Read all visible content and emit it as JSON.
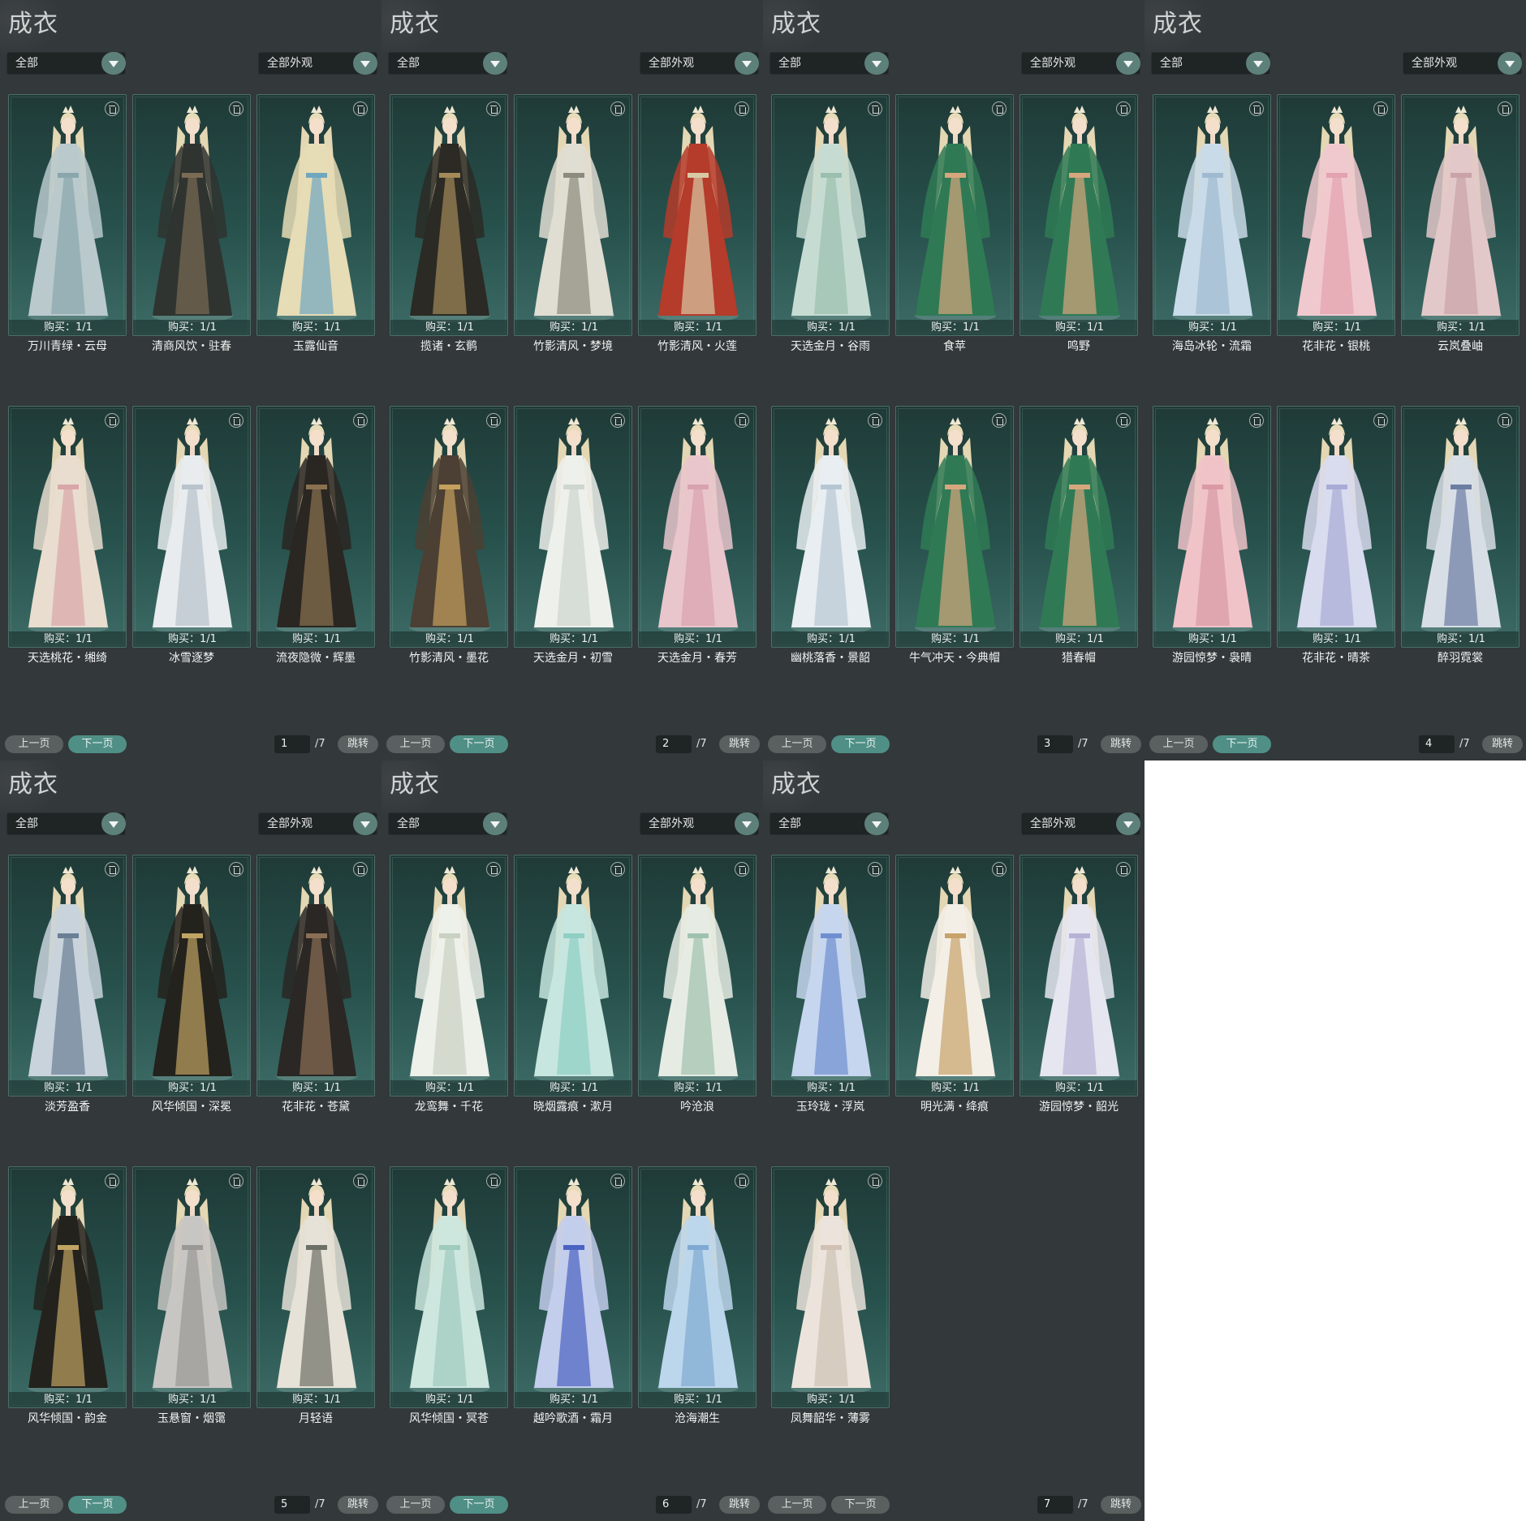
{
  "panels": [
    {
      "title": "成衣",
      "filter_left": "全部",
      "filter_right": "全部外观",
      "page": "1",
      "total": "/7",
      "prev": "上一页",
      "next": "下一页",
      "jump": "跳转",
      "next_enabled": true,
      "items": [
        {
          "name": "万川青绿・云母",
          "purchase": "购买：1/1",
          "dress": "#b9c9cc",
          "accent": "#8aa6ad"
        },
        {
          "name": "清商风饮・驻春",
          "purchase": "购买：1/1",
          "dress": "#2f3430",
          "accent": "#7a6b55"
        },
        {
          "name": "玉露仙音",
          "purchase": "购买：1/1",
          "dress": "#e6dcb5",
          "accent": "#6fa7c0"
        },
        {
          "name": "天选桃花・缃绮",
          "purchase": "购买：1/1",
          "dress": "#e9ddd0",
          "accent": "#d9a6a8"
        },
        {
          "name": "冰雪逐梦",
          "purchase": "购买：1/1",
          "dress": "#e8ecef",
          "accent": "#b9c3cc"
        },
        {
          "name": "流夜隐微・辉墨",
          "purchase": "购买：1/1",
          "dress": "#2a2622",
          "accent": "#8a7250"
        }
      ]
    },
    {
      "title": "成衣",
      "filter_left": "全部",
      "filter_right": "全部外观",
      "page": "2",
      "total": "/7",
      "prev": "上一页",
      "next": "下一页",
      "jump": "跳转",
      "next_enabled": true,
      "items": [
        {
          "name": "揽诸・玄鹡",
          "purchase": "购买：1/1",
          "dress": "#2b2a24",
          "accent": "#a38a58"
        },
        {
          "name": "竹影清风・梦境",
          "purchase": "购买：1/1",
          "dress": "#e0ddd2",
          "accent": "#8d8a7e"
        },
        {
          "name": "竹影清风・火莲",
          "purchase": "购买：1/1",
          "dress": "#b53b2a",
          "accent": "#d8c9a6"
        },
        {
          "name": "竹影清风・墨花",
          "purchase": "购买：1/1",
          "dress": "#4b4033",
          "accent": "#c4a05c"
        },
        {
          "name": "天选金月・初雪",
          "purchase": "购买：1/1",
          "dress": "#eef0ec",
          "accent": "#cdd6cf"
        },
        {
          "name": "天选金月・春芳",
          "purchase": "购买：1/1",
          "dress": "#e9c6cc",
          "accent": "#d8a3ae"
        }
      ]
    },
    {
      "title": "成衣",
      "filter_left": "全部",
      "filter_right": "全部外观",
      "page": "3",
      "total": "/7",
      "prev": "上一页",
      "next": "下一页",
      "jump": "跳转",
      "next_enabled": true,
      "items": [
        {
          "name": "天选金月・谷雨",
          "purchase": "购买：1/1",
          "dress": "#c6dcd2",
          "accent": "#9bbfae"
        },
        {
          "name": "食苹",
          "purchase": "购买：1/1",
          "dress": "#2f7a55",
          "accent": "#d6a77d"
        },
        {
          "name": "鸣野",
          "purchase": "购买：1/1",
          "dress": "#2f7a55",
          "accent": "#d6a77d"
        },
        {
          "name": "幽桃落香・景韶",
          "purchase": "购买：1/1",
          "dress": "#e9eef2",
          "accent": "#b6c7d4"
        },
        {
          "name": "牛气冲天・今典帽",
          "purchase": "购买：1/1",
          "dress": "#2f7a55",
          "accent": "#d6a77d"
        },
        {
          "name": "猎春帽",
          "purchase": "购买：1/1",
          "dress": "#2f7a55",
          "accent": "#d6a77d"
        }
      ]
    },
    {
      "title": "成衣",
      "filter_left": "全部",
      "filter_right": "全部外观",
      "page": "4",
      "total": "/7",
      "prev": "上一页",
      "next": "下一页",
      "jump": "跳转",
      "next_enabled": true,
      "items": [
        {
          "name": "海岛冰轮・流霜",
          "purchase": "购买：1/1",
          "dress": "#c9dbe8",
          "accent": "#9fbad0"
        },
        {
          "name": "花非花・银桃",
          "purchase": "购买：1/1",
          "dress": "#f0c9cf",
          "accent": "#e2a3ae"
        },
        {
          "name": "云岚叠岫",
          "purchase": "购买：1/1",
          "dress": "#e3c8c9",
          "accent": "#c9a3a6"
        },
        {
          "name": "游园惊梦・袅晴",
          "purchase": "购买：1/1",
          "dress": "#f0c3c9",
          "accent": "#d99aa4"
        },
        {
          "name": "花非花・晴茶",
          "purchase": "购买：1/1",
          "dress": "#d9dbef",
          "accent": "#a9acd6"
        },
        {
          "name": "醉羽霓裳",
          "purchase": "购买：1/1",
          "dress": "#d8dee6",
          "accent": "#6d7ea3"
        }
      ]
    },
    {
      "title": "成衣",
      "filter_left": "全部",
      "filter_right": "全部外观",
      "page": "5",
      "total": "/7",
      "prev": "上一页",
      "next": "下一页",
      "jump": "跳转",
      "next_enabled": true,
      "items": [
        {
          "name": "淡芳盈香",
          "purchase": "购买：1/1",
          "dress": "#c9d3dc",
          "accent": "#6a7f94"
        },
        {
          "name": "风华倾国・深冕",
          "purchase": "购买：1/1",
          "dress": "#24221d",
          "accent": "#c1a364"
        },
        {
          "name": "花非花・苍黛",
          "purchase": "购买：1/1",
          "dress": "#2a2724",
          "accent": "#8a6f55"
        },
        {
          "name": "风华倾国・韵金",
          "purchase": "购买：1/1",
          "dress": "#24221d",
          "accent": "#c1a364"
        },
        {
          "name": "玉悬窗・烟霭",
          "purchase": "购买：1/1",
          "dress": "#c8c6c3",
          "accent": "#9a9894"
        },
        {
          "name": "月轻语",
          "purchase": "购买：1/1",
          "dress": "#e6e2d8",
          "accent": "#6d7066"
        }
      ]
    },
    {
      "title": "成衣",
      "filter_left": "全部",
      "filter_right": "全部外观",
      "page": "6",
      "total": "/7",
      "prev": "上一页",
      "next": "下一页",
      "jump": "跳转",
      "next_enabled": true,
      "items": [
        {
          "name": "龙鸾舞・千花",
          "purchase": "购买：1/1",
          "dress": "#eef0ea",
          "accent": "#c9d1c2"
        },
        {
          "name": "晓烟露痕・漱月",
          "purchase": "购买：1/1",
          "dress": "#c7e6df",
          "accent": "#8fcfc3"
        },
        {
          "name": "吟沧浪",
          "purchase": "购买：1/1",
          "dress": "#e6ece4",
          "accent": "#9fc2ae"
        },
        {
          "name": "风华倾国・冥苍",
          "purchase": "购买：1/1",
          "dress": "#cde7df",
          "accent": "#9fcabe"
        },
        {
          "name": "越吟歌酒・霜月",
          "purchase": "购买：1/1",
          "dress": "#c3cdec",
          "accent": "#4a63c2"
        },
        {
          "name": "沧海潮生",
          "purchase": "购买：1/1",
          "dress": "#bcd6ec",
          "accent": "#7fa9d2"
        }
      ]
    },
    {
      "title": "成衣",
      "filter_left": "全部",
      "filter_right": "全部外观",
      "page": "7",
      "total": "/7",
      "prev": "上一页",
      "next": "下一页",
      "jump": "跳转",
      "next_enabled": false,
      "items": [
        {
          "name": "玉玲珑・浮岚",
          "purchase": "购买：1/1",
          "dress": "#c6d6ee",
          "accent": "#6f8fd0"
        },
        {
          "name": "明光满・绛痕",
          "purchase": "购买：1/1",
          "dress": "#f3efe6",
          "accent": "#c8a26a"
        },
        {
          "name": "游园惊梦・韶光",
          "purchase": "购买：1/1",
          "dress": "#e6e6f0",
          "accent": "#b6b2d6"
        },
        {
          "name": "凤舞韶华・薄雾",
          "purchase": "购买：1/1",
          "dress": "#ece4dc",
          "accent": "#cfc2b4"
        }
      ]
    }
  ]
}
